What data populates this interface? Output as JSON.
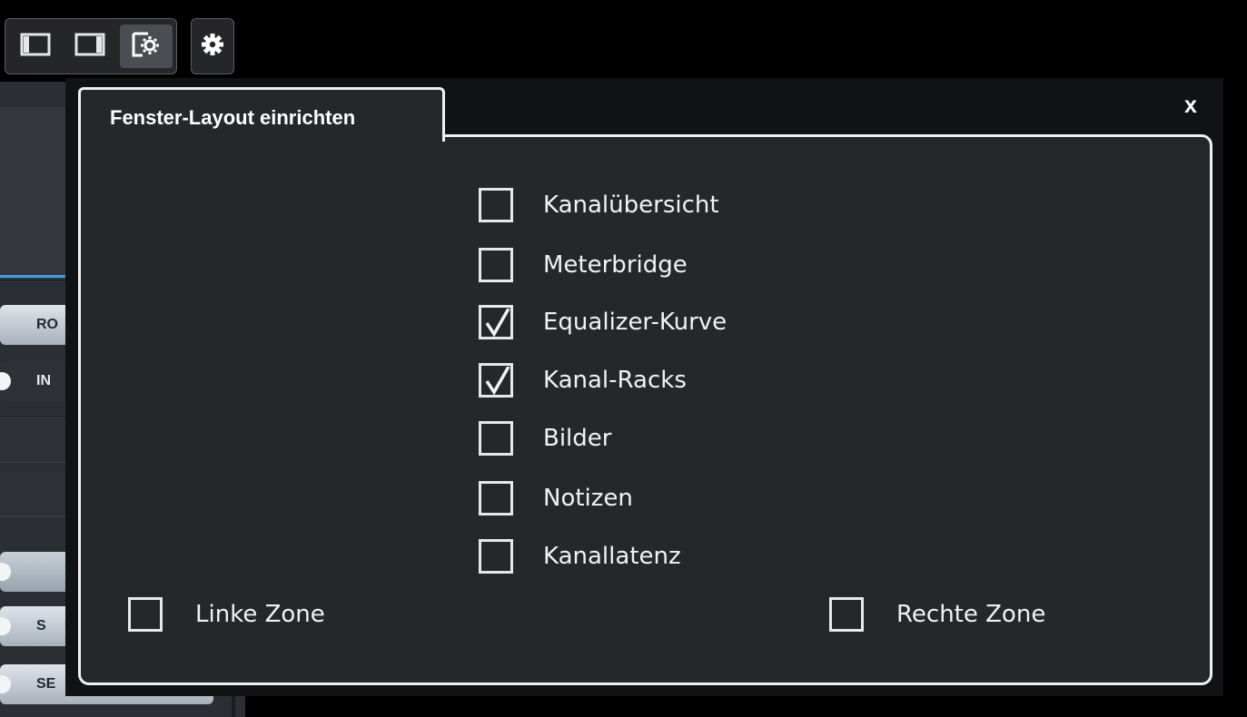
{
  "toolbar": {
    "buttons": [
      {
        "name": "left-zone-toggle",
        "icon": "left-panel-icon"
      },
      {
        "name": "right-zone-toggle",
        "icon": "right-panel-icon"
      },
      {
        "name": "window-layout-button",
        "icon": "layout-settings-icon",
        "active": true
      }
    ],
    "settings_icon": "gear-icon"
  },
  "background": {
    "pills": [
      "RO",
      "IN",
      "",
      "S",
      "SE"
    ]
  },
  "dialog": {
    "title": "Fenster-Layout einrichten",
    "close_label": "x",
    "options": [
      {
        "label": "Kanalübersicht",
        "checked": false
      },
      {
        "label": "Meterbridge",
        "checked": false
      },
      {
        "label": "Equalizer-Kurve",
        "checked": true
      },
      {
        "label": "Kanal-Racks",
        "checked": true
      },
      {
        "label": "Bilder",
        "checked": false
      },
      {
        "label": "Notizen",
        "checked": false
      },
      {
        "label": "Kanallatenz",
        "checked": false
      }
    ],
    "left_zone": {
      "label": "Linke Zone",
      "checked": false
    },
    "right_zone": {
      "label": "Rechte Zone",
      "checked": false
    }
  },
  "colors": {
    "accent_blue": "#3fa0e0",
    "dialog_bg": "#25272b",
    "border": "#f0f0f0"
  }
}
